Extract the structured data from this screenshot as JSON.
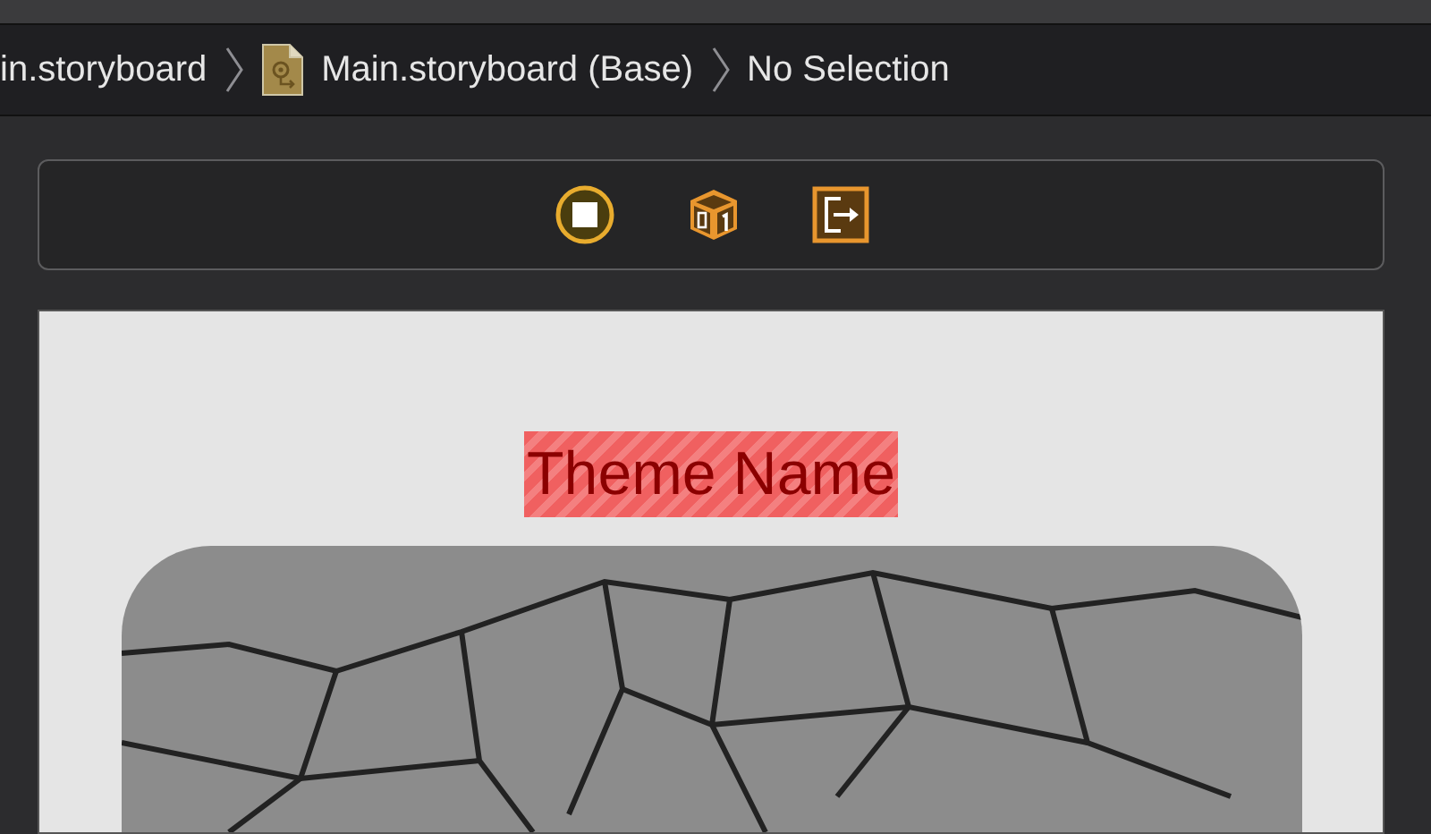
{
  "breadcrumbs": [
    {
      "kind": "plain",
      "label": "in.storyboard"
    },
    {
      "kind": "storyboard",
      "label": "Main.storyboard (Base)"
    },
    {
      "kind": "plain",
      "label": "No Selection"
    }
  ],
  "scene": {
    "label": "Theme Name"
  }
}
